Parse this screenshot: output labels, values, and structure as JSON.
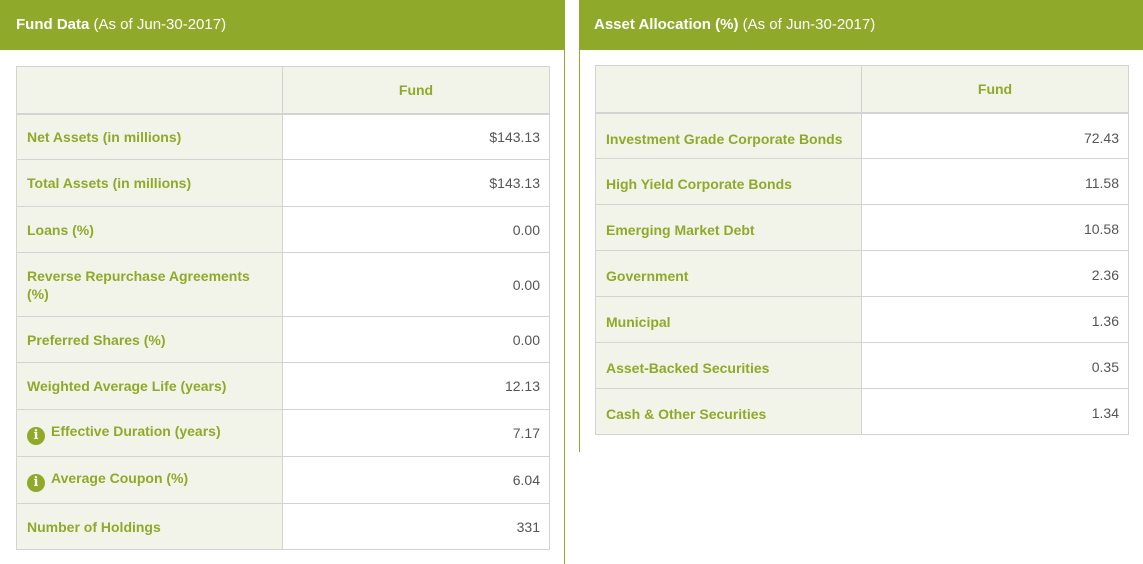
{
  "fund_data": {
    "title": "Fund Data",
    "as_of": "(As of Jun-30-2017)",
    "column_header": "Fund",
    "rows": [
      {
        "label": "Net Assets (in millions)",
        "value": "$143.13",
        "info": false
      },
      {
        "label": "Total Assets (in millions)",
        "value": "$143.13",
        "info": false
      },
      {
        "label": "Loans (%)",
        "value": "0.00",
        "info": false
      },
      {
        "label": "Reverse Repurchase Agreements (%)",
        "value": "0.00",
        "info": false
      },
      {
        "label": "Preferred Shares (%)",
        "value": "0.00",
        "info": false
      },
      {
        "label": "Weighted Average Life (years)",
        "value": "12.13",
        "info": false
      },
      {
        "label": "Effective Duration (years)",
        "value": "7.17",
        "info": true
      },
      {
        "label": "Average Coupon (%)",
        "value": "6.04",
        "info": true
      },
      {
        "label": "Number of Holdings",
        "value": "331",
        "info": false
      }
    ]
  },
  "asset_allocation": {
    "title": "Asset Allocation (%)",
    "as_of": "(As of Jun-30-2017)",
    "column_header": "Fund",
    "rows": [
      {
        "label": "Investment Grade Corporate Bonds",
        "value": "72.43"
      },
      {
        "label": "High Yield Corporate Bonds",
        "value": "11.58"
      },
      {
        "label": "Emerging Market Debt",
        "value": "10.58"
      },
      {
        "label": "Government",
        "value": "2.36"
      },
      {
        "label": "Municipal",
        "value": "1.36"
      },
      {
        "label": "Asset-Backed Securities",
        "value": "0.35"
      },
      {
        "label": "Cash & Other Securities",
        "value": "1.34"
      }
    ]
  },
  "colors": {
    "accent": "#8fa92a",
    "label_bg": "#f3f4e9",
    "border": "#d3d3d3",
    "value_text": "#555555"
  },
  "icons": {
    "info": "info-icon"
  }
}
